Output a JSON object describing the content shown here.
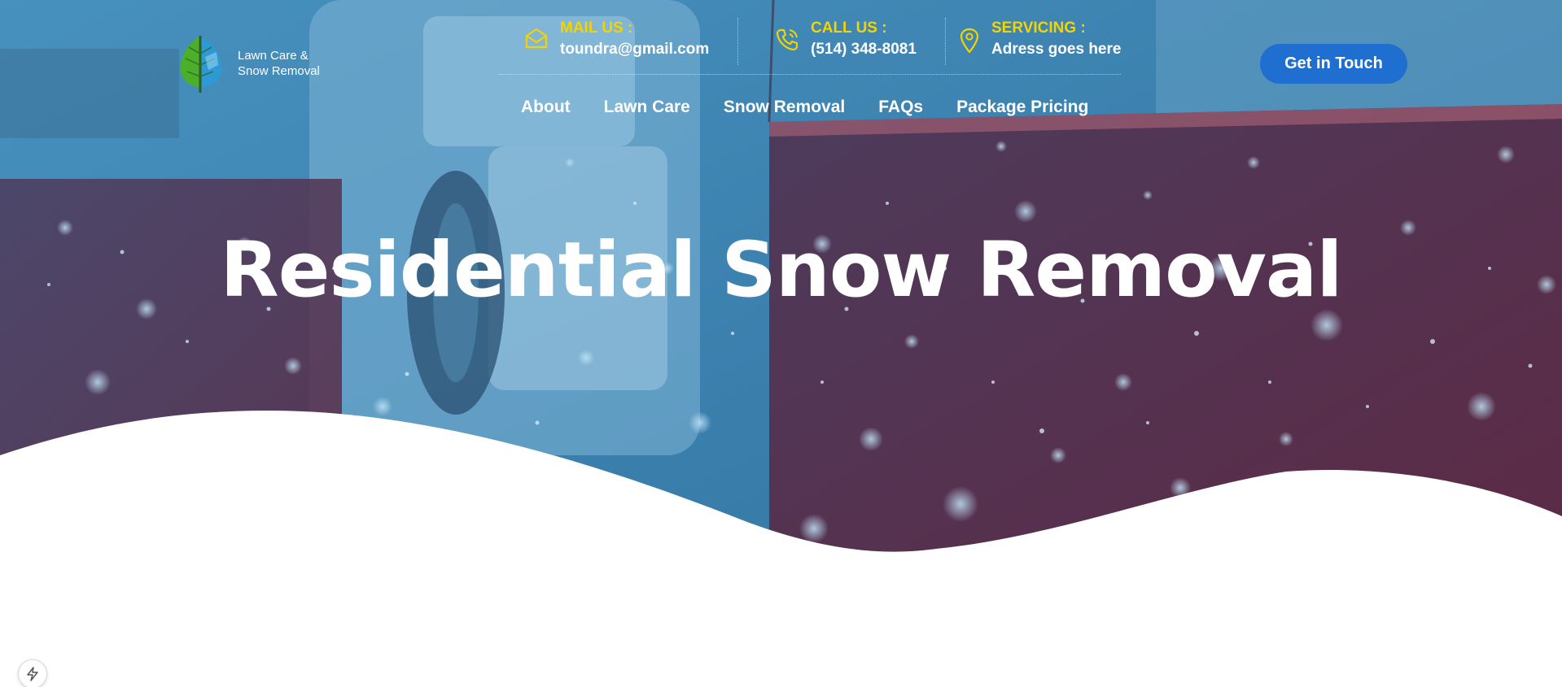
{
  "brand": {
    "line1": "Lawn Care &",
    "line2": "Snow Removal"
  },
  "contacts": {
    "mail": {
      "label": "MAIL US :",
      "value": "toundra@gmail.com",
      "icon": "envelope-icon"
    },
    "call": {
      "label": "CALL US :",
      "value": "(514) 348-8081",
      "icon": "phone-icon"
    },
    "servicing": {
      "label": "SERVICING :",
      "value": "Adress goes here",
      "icon": "map-pin-icon"
    }
  },
  "cta_label": "Get in Touch",
  "nav": [
    "About",
    "Lawn Care",
    "Snow Removal",
    "FAQs",
    "Package Pricing"
  ],
  "hero_title": "Residential Snow Removal",
  "colors": {
    "accent_yellow": "#f5d300",
    "button_blue": "#1f6fd0",
    "overlay_blue": "#3e8bb8",
    "plow_red": "#5a2c48"
  }
}
